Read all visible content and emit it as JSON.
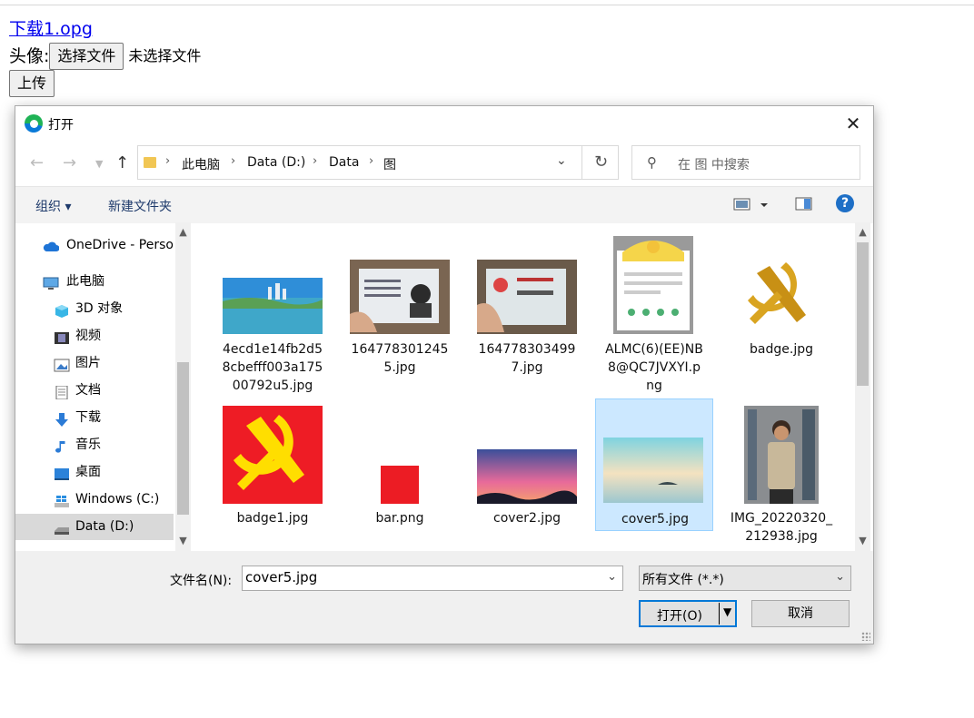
{
  "page": {
    "link_text": "下载1.opg",
    "avatar_label": "头像:",
    "choose_file_button": "选择文件",
    "no_file_text": "未选择文件",
    "upload_button": "上传"
  },
  "dialog": {
    "title": "打开",
    "close_glyph": "✕",
    "breadcrumb": [
      "此电脑",
      "Data (D:)",
      "Data",
      "图"
    ],
    "search_placeholder": "在 图 中搜索",
    "organize_label": "组织 ▾",
    "new_folder_label": "新建文件夹",
    "help_glyph": "?",
    "nav_items": [
      {
        "label": "OneDrive - Perso",
        "icon": "cloud-icon"
      },
      {
        "label": "此电脑",
        "icon": "computer-icon"
      },
      {
        "label": "3D 对象",
        "icon": "cube-icon"
      },
      {
        "label": "视频",
        "icon": "film-icon"
      },
      {
        "label": "图片",
        "icon": "image-icon"
      },
      {
        "label": "文档",
        "icon": "document-icon"
      },
      {
        "label": "下载",
        "icon": "download-icon"
      },
      {
        "label": "音乐",
        "icon": "music-icon"
      },
      {
        "label": "桌面",
        "icon": "desktop-icon"
      },
      {
        "label": "Windows (C:)",
        "icon": "windows-drive-icon"
      },
      {
        "label": "Data (D:)",
        "icon": "drive-icon",
        "selected": true
      }
    ],
    "files": [
      {
        "name": "4ecd1e14fb2d58cbefff003a17500792u5.jpg",
        "lines": [
          "4ecd1e14fb2d5",
          "8cbefff003a175",
          "00792u5.jpg"
        ]
      },
      {
        "name": "1647783012455.jpg",
        "lines": [
          "164778301245",
          "5.jpg"
        ]
      },
      {
        "name": "1647783034997.jpg",
        "lines": [
          "164778303499",
          "7.jpg"
        ]
      },
      {
        "name": "ALMC(6)(EE)NB8@QC7JVXYI.png",
        "lines": [
          "ALMC(6)(EE)NB",
          "8@QC7JVXYI.p",
          "ng"
        ]
      },
      {
        "name": "badge.jpg",
        "lines": [
          "badge.jpg"
        ]
      },
      {
        "name": "badge1.jpg",
        "lines": [
          "badge1.jpg"
        ]
      },
      {
        "name": "bar.png",
        "lines": [
          "bar.png"
        ]
      },
      {
        "name": "cover2.jpg",
        "lines": [
          "cover2.jpg"
        ]
      },
      {
        "name": "cover5.jpg",
        "lines": [
          "cover5.jpg"
        ],
        "selected": true
      },
      {
        "name": "IMG_20220320_212938.jpg",
        "lines": [
          "IMG_20220320_",
          "212938.jpg"
        ]
      }
    ],
    "filename_label": "文件名(N):",
    "filename_value": "cover5.jpg",
    "filetype_value": "所有文件 (*.*)",
    "open_button": "打开(O)",
    "cancel_button": "取消"
  },
  "colors": {
    "accent": "#0078d7",
    "selection": "#cce8ff",
    "link": "#0000ee"
  }
}
